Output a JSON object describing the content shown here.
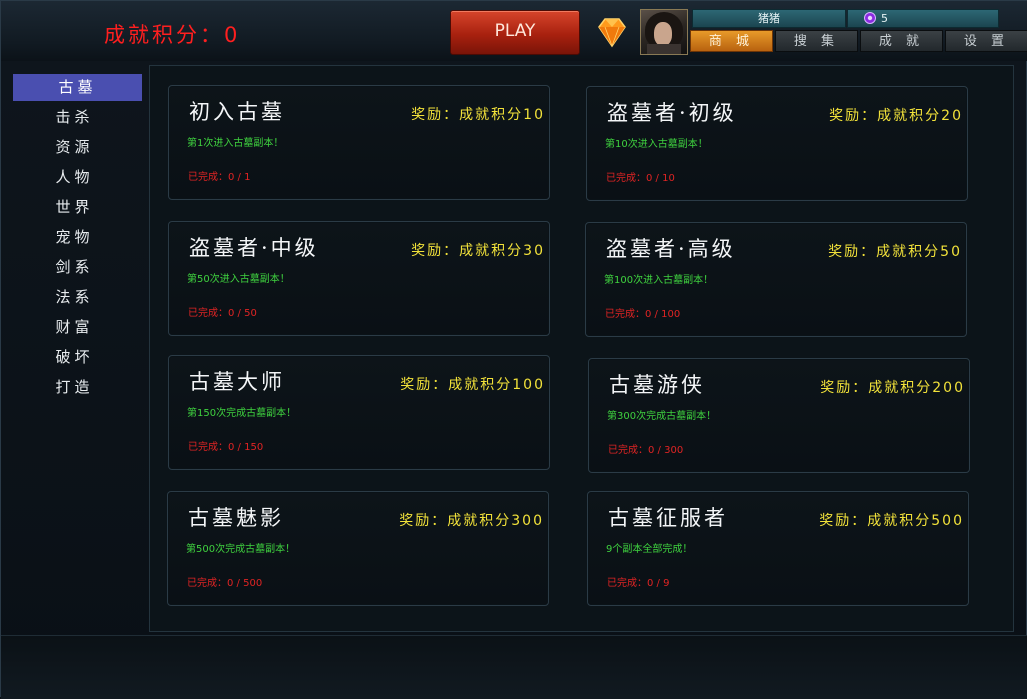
{
  "header": {
    "score_label": "成就积分：0",
    "play_label": "PLAY",
    "player_name": "猪猪",
    "gem_count": "5",
    "nav": [
      "商 城",
      "搜 集",
      "成 就",
      "设 置"
    ],
    "nav_active_index": 0
  },
  "sidebar": {
    "active_index": 0,
    "items": [
      "古墓",
      "击杀",
      "资源",
      "人物",
      "世界",
      "宠物",
      "剑系",
      "法系",
      "财富",
      "破坏",
      "打造"
    ]
  },
  "cards": [
    {
      "title": "初入古墓",
      "reward": "奖励：成就积分10",
      "desc": "第1次进入古墓副本！",
      "progress": "已完成：0 / 1"
    },
    {
      "title": "盗墓者·初级",
      "reward": "奖励：成就积分20",
      "desc": "第10次进入古墓副本！",
      "progress": "已完成：0 / 10"
    },
    {
      "title": "盗墓者·中级",
      "reward": "奖励：成就积分30",
      "desc": "第50次进入古墓副本！",
      "progress": "已完成：0 / 50"
    },
    {
      "title": "盗墓者·高级",
      "reward": "奖励：成就积分50",
      "desc": "第100次进入古墓副本！",
      "progress": "已完成：0 / 100"
    },
    {
      "title": "古墓大师",
      "reward": "奖励：成就积分100",
      "desc": "第150次完成古墓副本！",
      "progress": "已完成：0 / 150"
    },
    {
      "title": "古墓游侠",
      "reward": "奖励：成就积分200",
      "desc": "第300次完成古墓副本！",
      "progress": "已完成：0 / 300"
    },
    {
      "title": "古墓魅影",
      "reward": "奖励：成就积分300",
      "desc": "第500次完成古墓副本！",
      "progress": "已完成：0 / 500"
    },
    {
      "title": "古墓征服者",
      "reward": "奖励：成就积分500",
      "desc": "9个副本全部完成！",
      "progress": "已完成：0 / 9"
    }
  ],
  "colors": {
    "score": "#ff1f1f",
    "reward": "#f2e23a",
    "desc": "#3fd23f",
    "progress": "#e02424",
    "sidebar_active": "#4a4fb0",
    "nav_active": "#d27a1c"
  },
  "icons": {
    "gem": "diamond-icon",
    "currency": "purple-gem-icon",
    "avatar": "player-avatar"
  }
}
